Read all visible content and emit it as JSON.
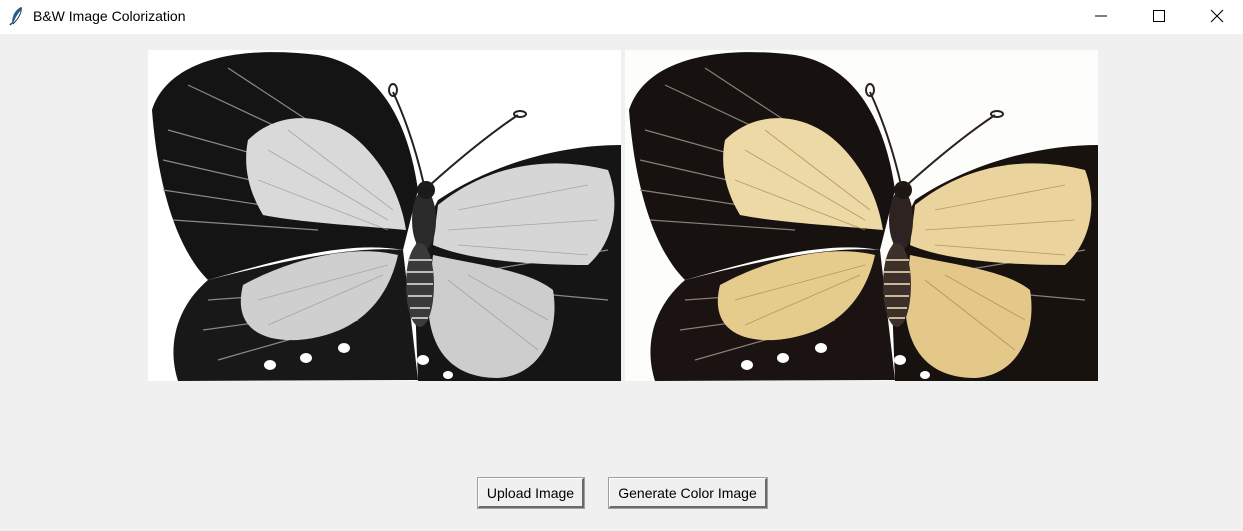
{
  "window": {
    "title": "B&W Image Colorization",
    "icon": "feather-icon",
    "controls": [
      "minimize-icon",
      "maximize-icon",
      "close-icon"
    ]
  },
  "images": {
    "original": {
      "kind": "grayscale butterfly photo"
    },
    "colorized": {
      "kind": "colorized butterfly photo",
      "wing_tint": "#e8cf93"
    }
  },
  "buttons": {
    "upload_label": "Upload Image",
    "generate_label": "Generate Color Image"
  },
  "colors": {
    "background": "#f0f0f0",
    "titlebar": "#ffffff",
    "bw_wing": "#d9d9d9",
    "color_wing": "#e8cf93",
    "wing_dark": "#141414"
  }
}
